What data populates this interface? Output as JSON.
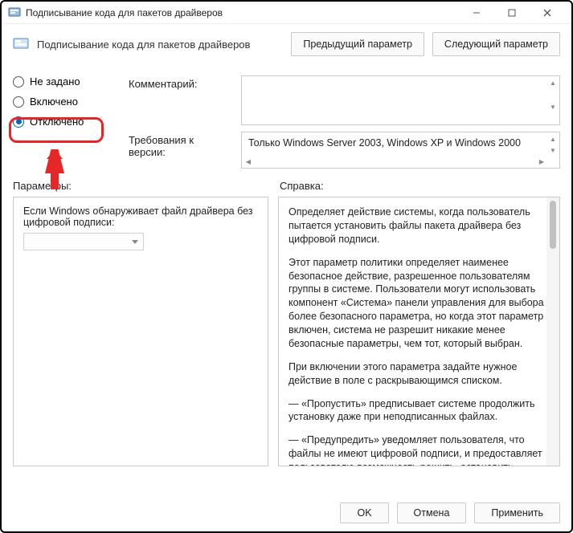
{
  "title": "Подписывание кода для пакетов драйверов",
  "header": {
    "title": "Подписывание кода для пакетов драйверов",
    "prev": "Предыдущий параметр",
    "next": "Следующий параметр"
  },
  "radios": {
    "notconfigured": "Не задано",
    "enabled": "Включено",
    "disabled": "Отключено",
    "selected": "disabled"
  },
  "labels": {
    "comment": "Комментарий:",
    "supported": "Требования к версии:",
    "options": "Параметры:",
    "help": "Справка:"
  },
  "supported_text": "Только Windows Server 2003, Windows XP и Windows 2000",
  "options_text": "Если Windows обнаруживает файл драйвера без цифровой подписи:",
  "help": {
    "p1": "Определяет действие системы, когда пользователь пытается установить файлы пакета драйвера без цифровой подписи.",
    "p2": "Этот параметр политики определяет наименее безопасное действие, разрешенное пользователям группы в системе. Пользователи могут использовать компонент «Система» панели управления для выбора более безопасного параметра, но когда этот параметр включен, система не разрешит никакие менее безопасные параметры, чем тот, который выбран.",
    "p3": "При включении этого параметра задайте нужное действие в поле с раскрывающимся списком.",
    "p4": "—   «Пропустить» предписывает системе продолжить установку даже при неподписанных файлах.",
    "p5": "—   «Предупредить» уведомляет пользователя, что файлы не имеют цифровой подписи, и предоставляет пользователю возможность решить, остановить установку или продолжить, и разрешить ли установку неподписанных файлов. Параметр"
  },
  "footer": {
    "ok": "OK",
    "cancel": "Отмена",
    "apply": "Применить"
  }
}
